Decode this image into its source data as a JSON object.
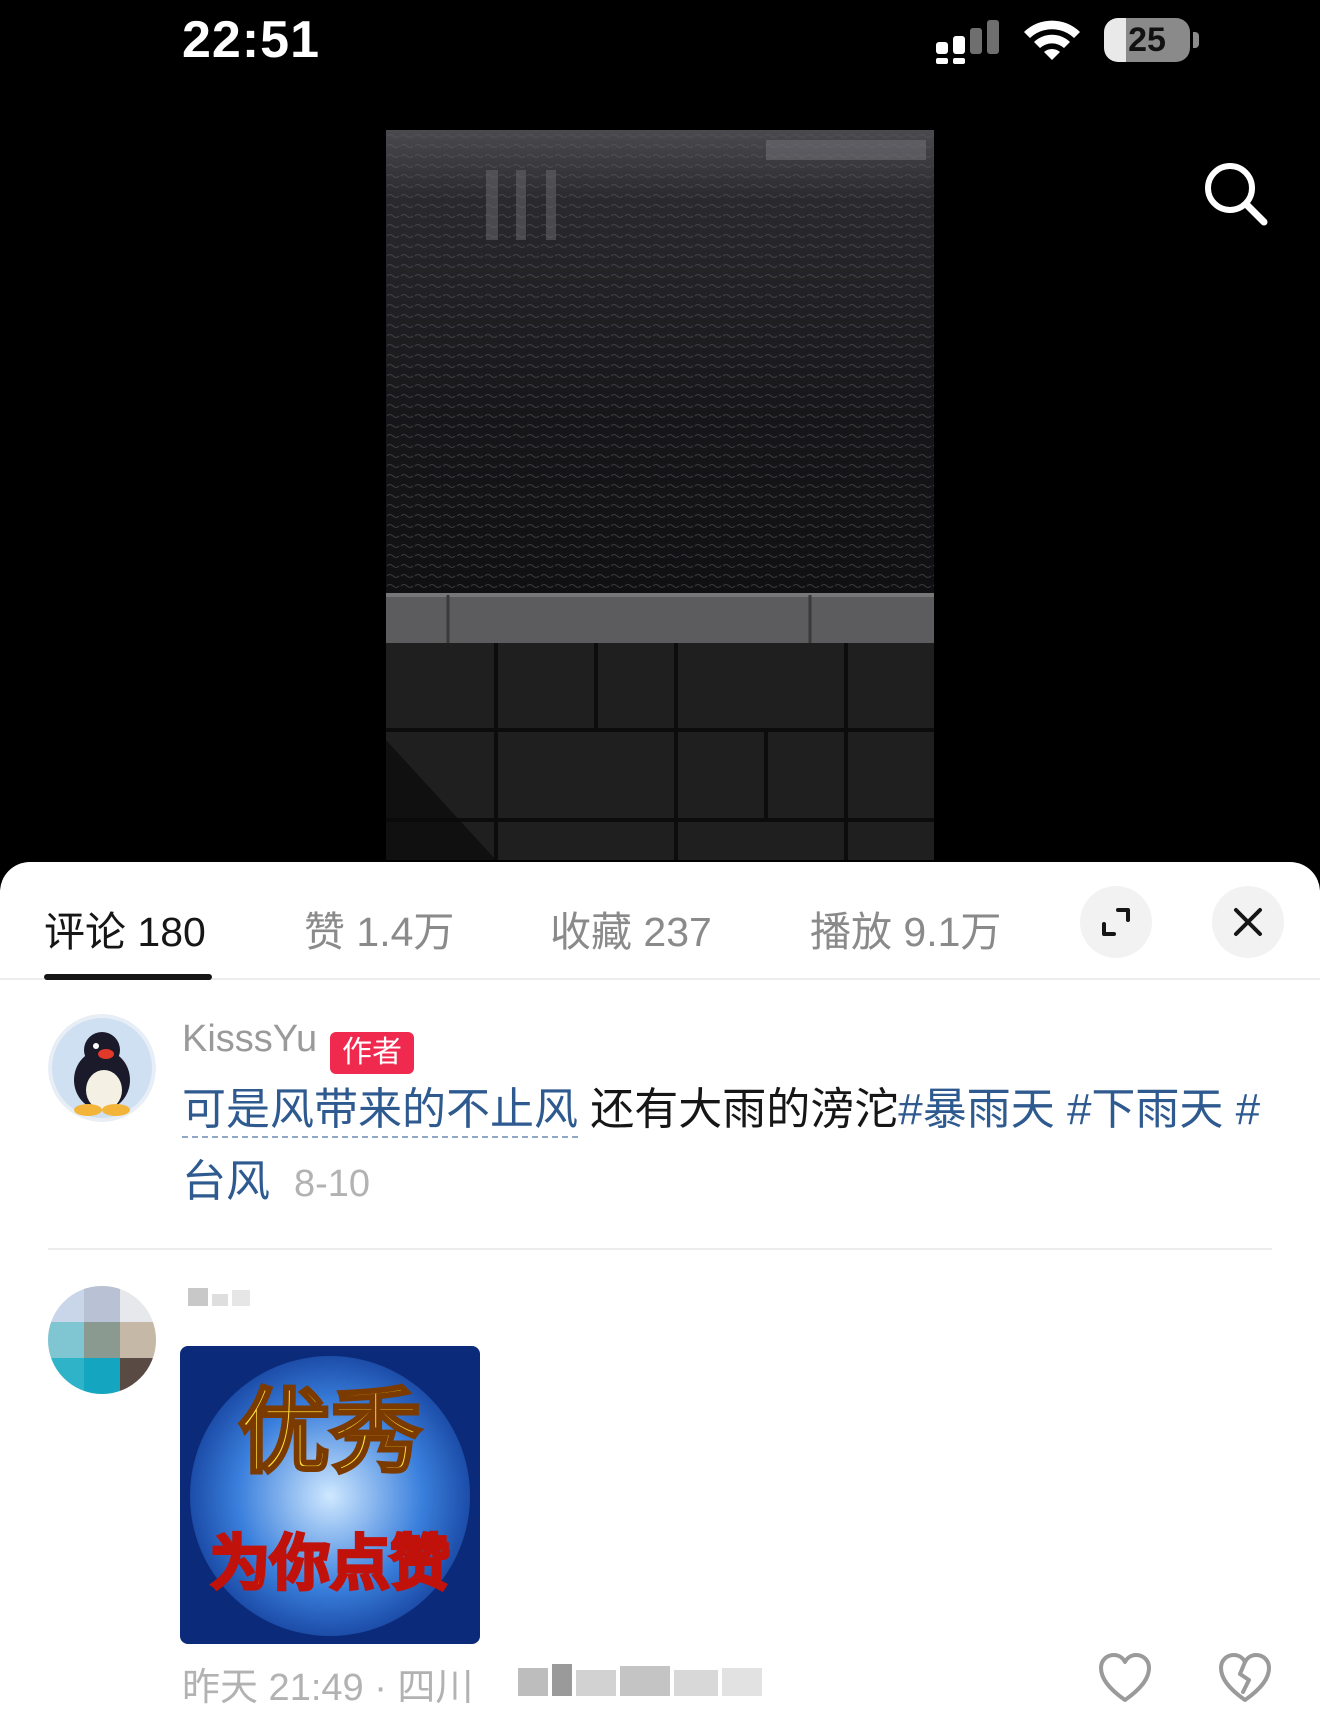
{
  "status_bar": {
    "time": "22:51",
    "battery_level": "25",
    "battery_fraction": 0.25
  },
  "header": {
    "search_icon": "search-icon"
  },
  "tabs": [
    {
      "label": "评论",
      "count": "180",
      "active": true
    },
    {
      "label": "赞",
      "count": "1.4万",
      "active": false
    },
    {
      "label": "收藏",
      "count": "237",
      "active": false
    },
    {
      "label": "播放",
      "count": "9.1万",
      "active": false
    }
  ],
  "sheet_actions": {
    "expand_icon": "expand-icon",
    "close_icon": "close-icon"
  },
  "comments": [
    {
      "username": "KisssYu",
      "badge": "作者",
      "quote": "可是风带来的不止风",
      "text": " 还有大雨的滂沱",
      "tags": [
        "#暴雨天",
        "#下雨天",
        "#台风"
      ],
      "date": "8-10"
    },
    {
      "sticker_title": "优秀",
      "sticker_subtitle": "为你点赞",
      "time_location": "昨天 21:49 · 四川",
      "like_icon": "heart-icon",
      "dislike_icon": "broken-heart-icon"
    }
  ],
  "colors": {
    "link": "#2e5a8f",
    "badge": "#f0294f",
    "muted": "#9a9a9a"
  }
}
